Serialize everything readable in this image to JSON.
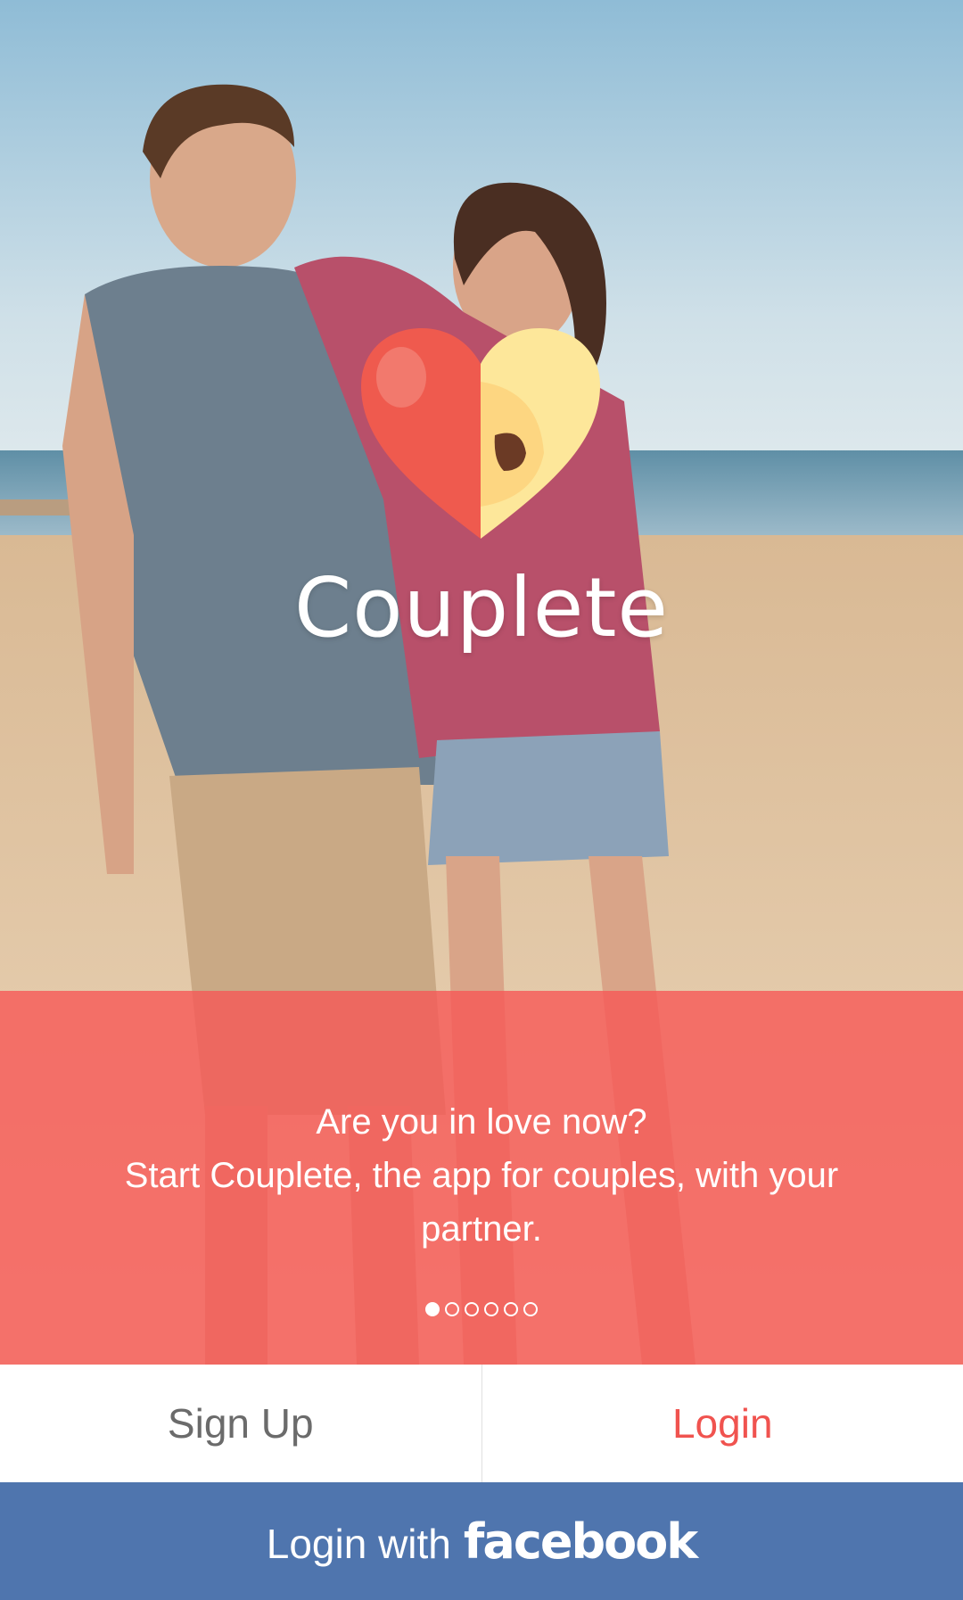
{
  "app": {
    "name": "Couplete"
  },
  "onboarding": {
    "tagline_line1": "Are you in love now?",
    "tagline_line2": "Start Couplete, the app for couples, with your partner.",
    "page_count": 6,
    "active_page": 1
  },
  "auth": {
    "signup_label": "Sign Up",
    "login_label": "Login",
    "facebook_prefix": "Login with",
    "facebook_brand": "facebook"
  },
  "colors": {
    "overlay": "#f65856",
    "login_text": "#f0534f",
    "facebook_bg": "#4f75ae",
    "signup_text": "#6b6b6b"
  },
  "icons": {
    "logo": "heart-logo-icon"
  }
}
